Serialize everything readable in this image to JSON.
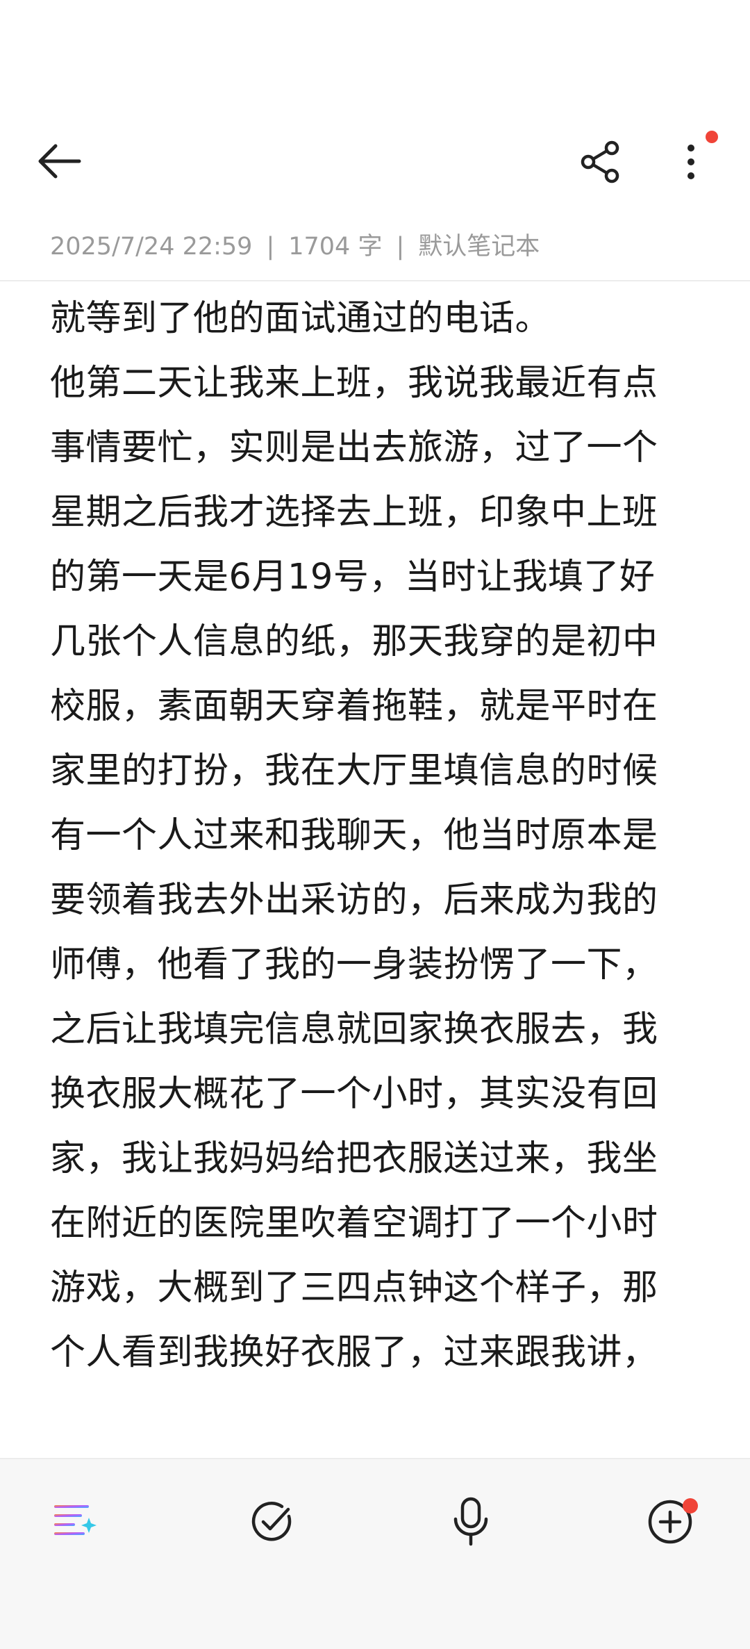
{
  "header": {
    "icons": {
      "back": "arrow-left-icon",
      "share": "share-icon",
      "more": "more-vertical-icon"
    },
    "more_has_badge": true
  },
  "note": {
    "date": "2025/7/24 22:59",
    "word_count": "1704 字",
    "notebook": "默认笔记本",
    "separator": "|",
    "lines": [
      "就等到了他的面试通过的电话。",
      "他第二天让我来上班，我说我最近有点",
      "事情要忙，实则是出去旅游，过了一个",
      "星期之后我才选择去上班，印象中上班",
      "的第一天是6月19号，当时让我填了好",
      "几张个人信息的纸，那天我穿的是初中",
      "校服，素面朝天穿着拖鞋，就是平时在",
      "家里的打扮，我在大厅里填信息的时候",
      "有一个人过来和我聊天，他当时原本是",
      "要领着我去外出采访的，后来成为我的",
      "师傅，他看了我的一身装扮愣了一下，",
      "之后让我填完信息就回家换衣服去，我",
      "换衣服大概花了一个小时，其实没有回",
      "家，我让我妈妈给把衣服送过来，我坐",
      "在附近的医院里吹着空调打了一个小时",
      "游戏，大概到了三四点钟这个样子，那",
      "个人看到我换好衣服了，过来跟我讲，"
    ]
  },
  "toolbar": {
    "icons": {
      "ai_format": "ai-sparkle-list-icon",
      "checklist": "check-circle-icon",
      "voice": "microphone-icon",
      "add": "add-circle-icon"
    },
    "add_has_badge": true
  },
  "colors": {
    "badge": "#f04438",
    "text": "#1a1a1a",
    "meta": "#9a9a9a",
    "icon": "#222222"
  }
}
